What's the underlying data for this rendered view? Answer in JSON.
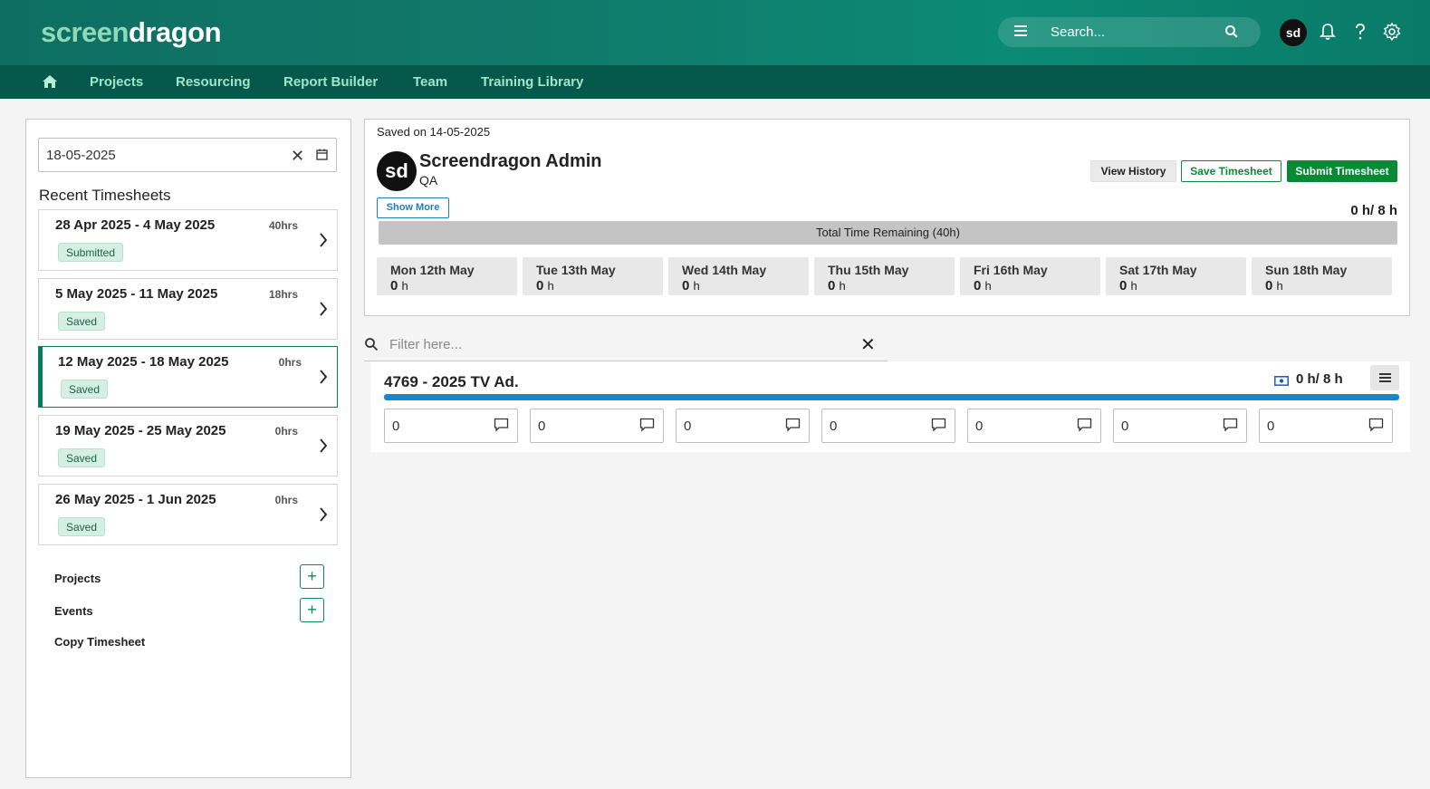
{
  "header": {
    "logo_part1": "screen",
    "logo_part2": "dragon",
    "search_placeholder": "Search...",
    "avatar_initials": "sd"
  },
  "nav": {
    "items": [
      "Projects",
      "Resourcing",
      "Report Builder",
      "Team",
      "Training Library"
    ]
  },
  "left_panel": {
    "date_value": "18-05-2025",
    "recent_title": "Recent Timesheets",
    "timesheets": [
      {
        "range": "28 Apr 2025 - 4 May 2025",
        "hours": "40hrs",
        "status": "Submitted"
      },
      {
        "range": "5 May 2025 - 11 May 2025",
        "hours": "18hrs",
        "status": "Saved"
      },
      {
        "range": "12 May 2025 - 18 May 2025",
        "hours": "0hrs",
        "status": "Saved"
      },
      {
        "range": "19 May 2025 - 25 May 2025",
        "hours": "0hrs",
        "status": "Saved"
      },
      {
        "range": "26 May 2025 - 1 Jun 2025",
        "hours": "0hrs",
        "status": "Saved"
      }
    ],
    "projects_label": "Projects",
    "events_label": "Events",
    "copy_label": "Copy Timesheet"
  },
  "summary": {
    "saved_on": "Saved on 14-05-2025",
    "avatar_initials": "sd",
    "user_name": "Screendragon Admin",
    "user_role": "QA",
    "view_history": "View History",
    "save_timesheet": "Save Timesheet",
    "submit_timesheet": "Submit Timesheet",
    "show_more": "Show More",
    "total_hours": "0 h/ 8 h",
    "remaining": "Total Time Remaining (40h)",
    "days": [
      {
        "name": "Mon 12th May",
        "hours": "0",
        "unit": "h"
      },
      {
        "name": "Tue 13th May",
        "hours": "0",
        "unit": "h"
      },
      {
        "name": "Wed 14th May",
        "hours": "0",
        "unit": "h"
      },
      {
        "name": "Thu 15th May",
        "hours": "0",
        "unit": "h"
      },
      {
        "name": "Fri 16th May",
        "hours": "0",
        "unit": "h"
      },
      {
        "name": "Sat 17th May",
        "hours": "0",
        "unit": "h"
      },
      {
        "name": "Sun 18th May",
        "hours": "0",
        "unit": "h"
      }
    ]
  },
  "filter": {
    "placeholder": "Filter here..."
  },
  "project": {
    "name": "4769 - 2025 TV Ad.",
    "hours": "0 h/ 8 h",
    "cells": [
      "0",
      "0",
      "0",
      "0",
      "0",
      "0",
      "0"
    ]
  },
  "colors": {
    "brand_green": "#078a33",
    "nav_bg": "#06584d",
    "progress_blue": "#1a86c8"
  }
}
